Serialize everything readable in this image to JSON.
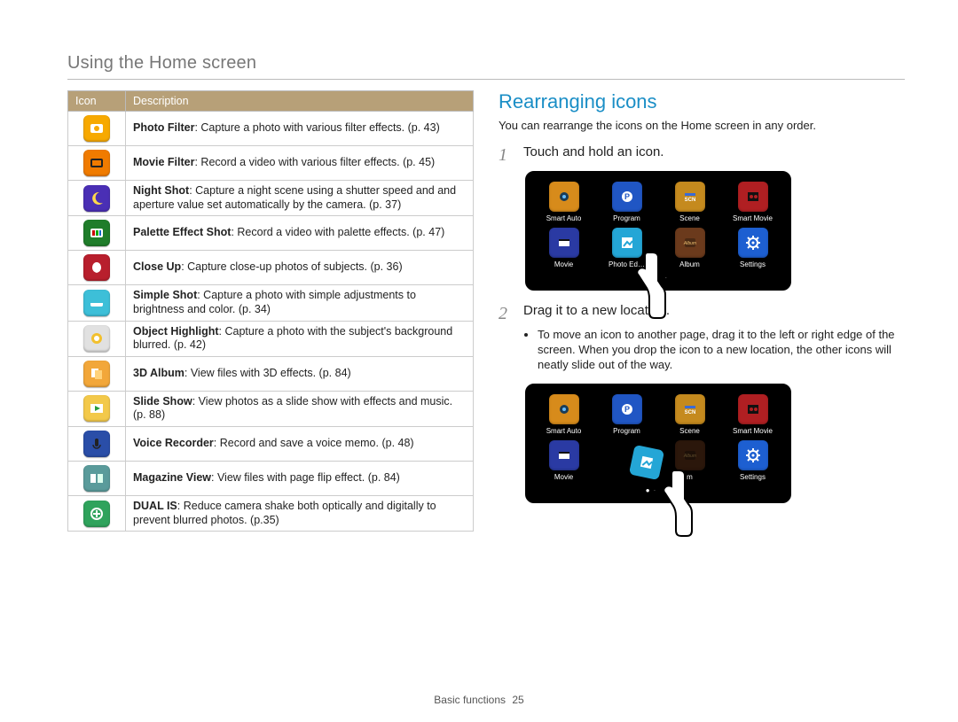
{
  "page_title": "Using the Home screen",
  "table": {
    "header_icon": "Icon",
    "header_desc": "Description",
    "rows": [
      {
        "icon": "photo-filter",
        "bg": "#f7a900",
        "term": "Photo Filter",
        "rest": ": Capture a photo with various filter effects. (p. 43)"
      },
      {
        "icon": "movie-filter",
        "bg": "#f07b00",
        "term": "Movie Filter",
        "rest": ": Record a video with various filter effects. (p. 45)"
      },
      {
        "icon": "night-shot",
        "bg": "#4a2fb5",
        "term": "Night Shot",
        "rest": ": Capture a night scene using a shutter speed and and aperture value set automatically by the camera. (p. 37)"
      },
      {
        "icon": "palette-shot",
        "bg": "#1f7d2a",
        "term": "Palette Effect Shot",
        "rest": ": Record a video with palette effects. (p. 47)"
      },
      {
        "icon": "close-up",
        "bg": "#b81f2d",
        "term": "Close Up",
        "rest": ": Capture close-up photos of subjects. (p. 36)"
      },
      {
        "icon": "simple-shot",
        "bg": "#3dbfd8",
        "term": "Simple Shot",
        "rest": ": Capture a photo with simple adjustments to brightness and color. (p. 34)"
      },
      {
        "icon": "object-hl",
        "bg": "#e1e1e1",
        "term": "Object Highlight",
        "rest": ": Capture a photo with the subject's background blurred. (p. 42)"
      },
      {
        "icon": "3d-album",
        "bg": "#f2a73a",
        "term": "3D Album",
        "rest": ": View files with 3D effects. (p. 84)"
      },
      {
        "icon": "slide-show",
        "bg": "#f3c94a",
        "term": "Slide Show",
        "rest": ": View photos as a slide show with effects and music. (p. 88)"
      },
      {
        "icon": "voice-rec",
        "bg": "#2a4ea8",
        "term": "Voice Recorder",
        "rest": ": Record and save a voice memo. (p. 48)"
      },
      {
        "icon": "magazine",
        "bg": "#5a9b9b",
        "term": "Magazine View",
        "rest": ": View files with page flip effect. (p. 84)"
      },
      {
        "icon": "dual-is",
        "bg": "#2fa35c",
        "term": "DUAL IS",
        "rest": ": Reduce camera shake both optically and digitally to prevent blurred photos. (p.35)"
      }
    ]
  },
  "section": {
    "heading": "Rearranging icons",
    "lead": "You can rearrange the icons on the Home screen in any order.",
    "step1_num": "1",
    "step1": "Touch and hold an icon.",
    "step2_num": "2",
    "step2": "Drag it to a new location.",
    "bullet": "To move an icon to another page, drag it to the left or right edge of the screen. When you drop the icon to a new location, the other icons will neatly slide out of the way."
  },
  "phone_icons": [
    {
      "label": "Smart Auto",
      "icon": "smart-auto",
      "bg": "#d78b1b"
    },
    {
      "label": "Program",
      "icon": "program",
      "bg": "#2056c4"
    },
    {
      "label": "Scene",
      "icon": "scene",
      "bg": "#c58a1e"
    },
    {
      "label": "Smart Movie",
      "icon": "smart-movie",
      "bg": "#b01f22"
    },
    {
      "label": "Movie",
      "icon": "movie",
      "bg": "#2a3aa3"
    },
    {
      "label": "Photo Editor",
      "icon": "photo-edit",
      "bg": "#24a6d6"
    },
    {
      "label": "Album",
      "icon": "album",
      "bg": "#6b3a1c"
    },
    {
      "label": "Settings",
      "icon": "settings",
      "bg": "#1d5fd1"
    }
  ],
  "phone2_dragged_label": "m",
  "footer": {
    "section": "Basic functions",
    "page": "25"
  }
}
